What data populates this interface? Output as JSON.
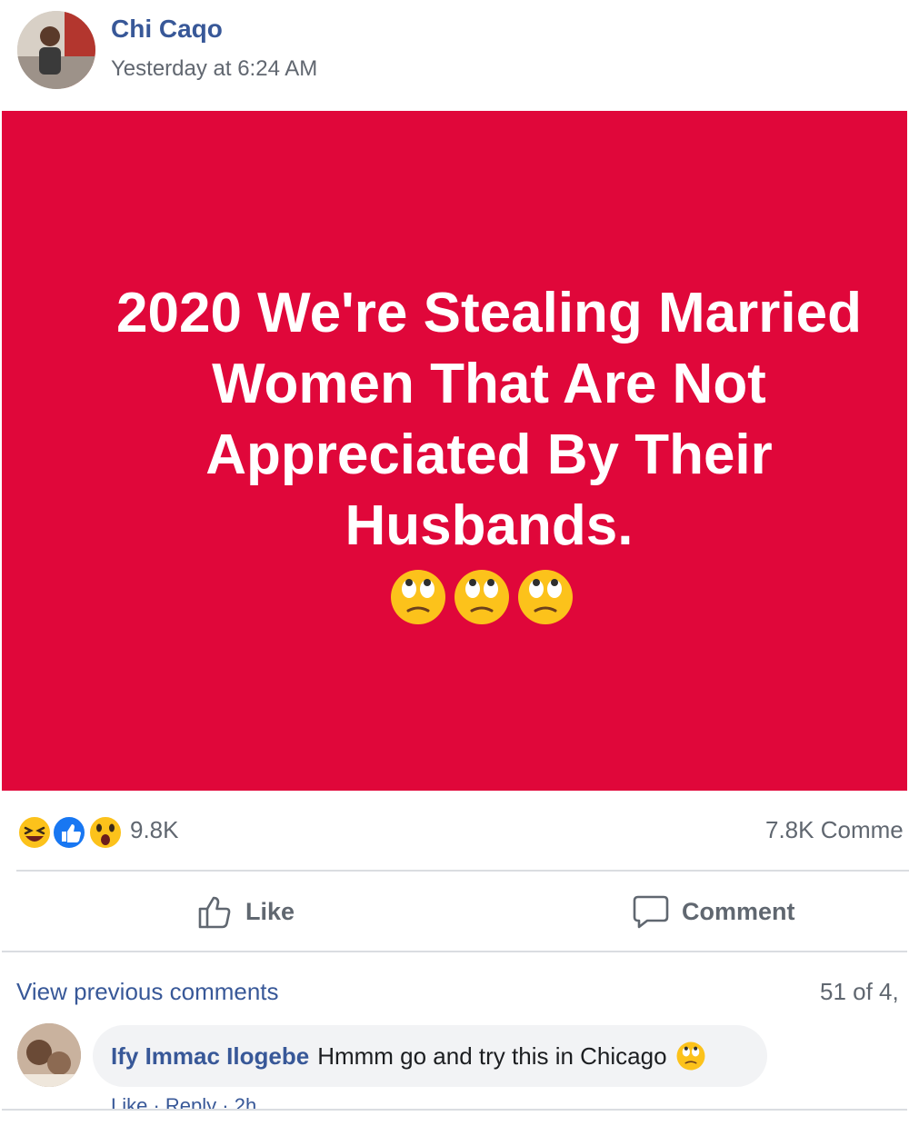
{
  "post": {
    "author": "Chi Caqo",
    "timestamp": "Yesterday at 6:24 AM",
    "image_text": [
      "2020 We're Stealing Married",
      "Women That Are Not",
      "Appreciated By Their",
      "Husbands."
    ],
    "image_bg_color": "#e0073a"
  },
  "reactions": {
    "icons": [
      "haha-icon",
      "like-icon",
      "wow-icon"
    ],
    "count": "9.8K",
    "comments_count": "7.8K Comme"
  },
  "actions": {
    "like_label": "Like",
    "comment_label": "Comment"
  },
  "comments": {
    "view_previous": "View previous comments",
    "paging": "51 of 4,",
    "items": [
      {
        "author": "Ify Immac Ilogebe",
        "text": "Hmmm go and try this in Chicago",
        "actions": "Like · Reply · 2h"
      }
    ]
  },
  "colors": {
    "link_blue": "#385898",
    "meta_gray": "#606770",
    "like_blue": "#1877f2",
    "emoji_yellow": "#fcc21b"
  }
}
